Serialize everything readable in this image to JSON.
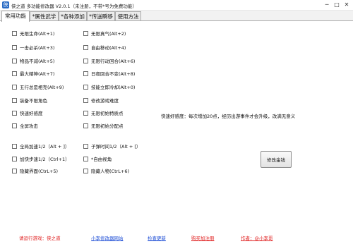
{
  "window": {
    "title": "侠之道 多功能修改器 V2.0.1（未注册，不带*号为免费功能）",
    "controls": {
      "minimize": "─",
      "maximize": "□",
      "close": "✕"
    }
  },
  "tabs": [
    "常用功能",
    "*属性武学",
    "*各种添加",
    "*传送瞬移",
    "使用方法"
  ],
  "options": {
    "left": [
      "无限生命(Alt+1)",
      "一击必杀(Alt+3)",
      "物品不减(Alt+5)",
      "最大精神(Alt+7)",
      "五行总是相克(Alt+9)",
      "装备不限角色",
      "快速好感度",
      "全屏攻击",
      "全局加速1/2（Alt + ]）",
      "加快步速1/2（Ctrl+1）",
      "隐藏界面(CtrL+5)"
    ],
    "right": [
      "无限真气(Alt+2)",
      "自由移动(Alt+4)",
      "无限行动回合(Alt+6)",
      "日夜回合不变(Alt+8)",
      "技能立即冷却(Alt+0)",
      "修改游戏难度",
      "无限初始特质点",
      "无限初始分配点",
      "子弹时间1/2（Alt + [）",
      "*自由视角",
      "隐藏人物(CtrL+6)"
    ]
  },
  "hint": "快速好感度：每次增加20点，经历出游事件才会升级，改满无意义",
  "modify_gold_button": "修改金钱",
  "footer": {
    "game": "请运行游戏：侠之道",
    "site": "小李修改器网站",
    "update": "检查更新",
    "buy": "购买加注册",
    "author": "作者：@小李哥"
  },
  "colors": {
    "footer_red": "#e02020",
    "footer_link": "#1f4fd6"
  }
}
